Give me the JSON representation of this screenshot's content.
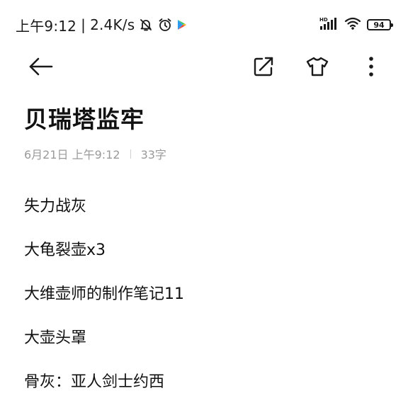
{
  "status_bar": {
    "time": "上午9:12",
    "network_speed": "2.4K/s",
    "icons": [
      "notifications-muted-icon",
      "alarm-icon",
      "play-store-icon",
      "hd-signal-icon",
      "wifi-icon"
    ],
    "signal_label": "HD",
    "battery_level": "94"
  },
  "toolbar": {
    "back_icon": "arrow-left-icon",
    "share_icon": "share-external-icon",
    "theme_icon": "tshirt-icon",
    "more_icon": "more-vertical-icon"
  },
  "note": {
    "title": "贝瑞塔监牢",
    "date": "6月21日 上午9:12",
    "word_count": "33字",
    "lines": [
      "失力战灰",
      "大龟裂壶x3",
      "大维壶师的制作笔记11",
      "大壶头罩",
      "骨灰：亚人剑士约西"
    ]
  },
  "colors": {
    "text_primary": "#111111",
    "text_meta": "#9a9a9a",
    "background": "#ffffff"
  }
}
